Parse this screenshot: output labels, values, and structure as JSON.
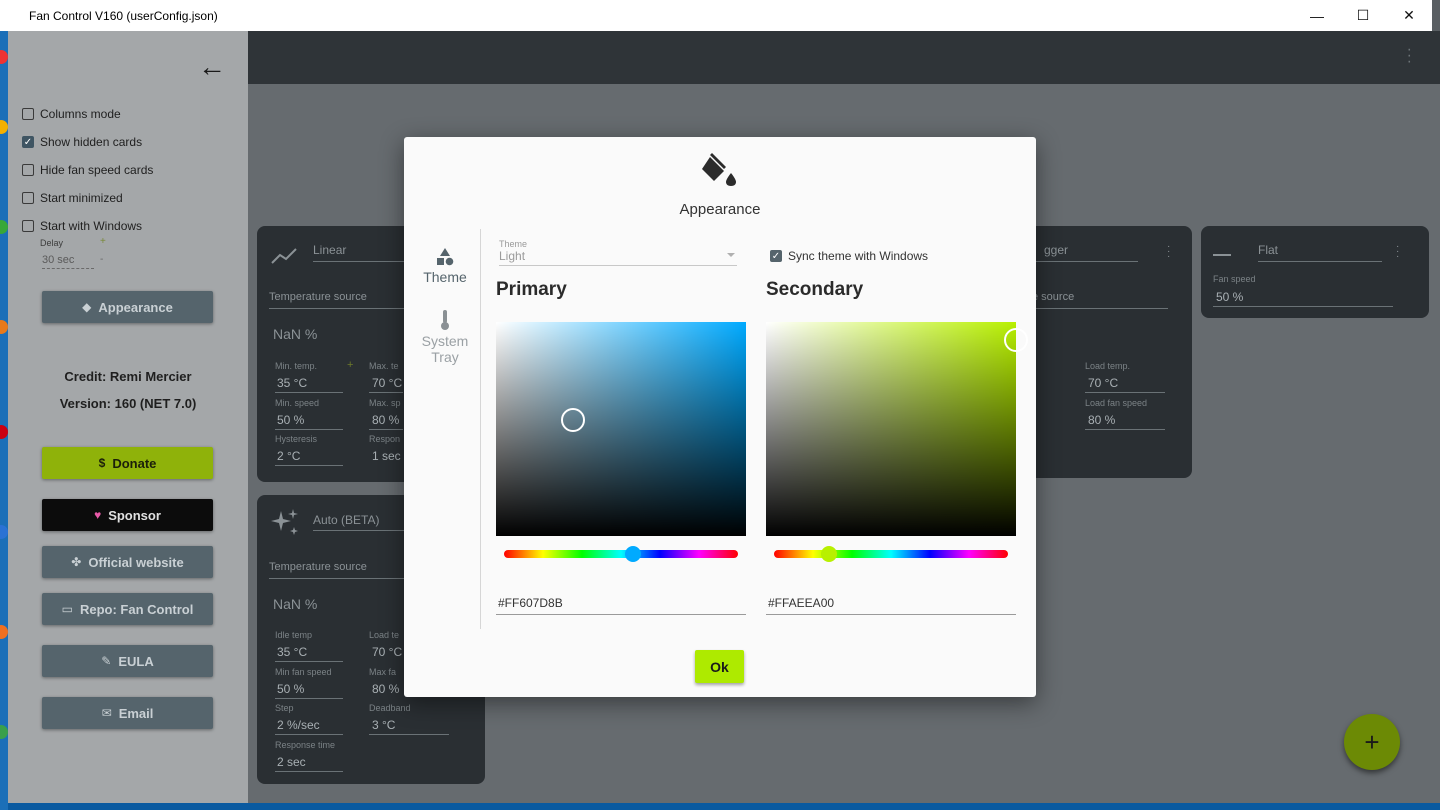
{
  "window": {
    "title": "Fan Control V160 (userConfig.json)",
    "controls": [
      "—",
      "☐",
      "✕"
    ]
  },
  "sidebar": {
    "checkboxes": [
      {
        "label": "Columns mode",
        "checked": false
      },
      {
        "label": "Show hidden cards",
        "checked": true
      },
      {
        "label": "Hide fan speed cards",
        "checked": false
      },
      {
        "label": "Start minimized",
        "checked": false
      },
      {
        "label": "Start with Windows",
        "checked": false
      }
    ],
    "delay_label": "Delay",
    "delay_value": "30 sec",
    "buttons": {
      "appearance": "Appearance",
      "donate": "Donate",
      "sponsor": "Sponsor",
      "website": "Official website",
      "repo": "Repo: Fan Control",
      "eula": "EULA",
      "email": "Email"
    },
    "credit": "Credit: Remi Mercier",
    "version": "Version: 160 (NET 7.0)"
  },
  "cards": {
    "linear": {
      "title": "Linear",
      "source_label": "Temperature source",
      "value": "NaN %",
      "min_temp_label": "Min. temp.",
      "min_temp": "35 °C",
      "max_temp_label": "Max. te",
      "max_temp": "70 °C",
      "min_speed_label": "Min. speed",
      "min_speed": "50 %",
      "max_speed_label": "Max. sp",
      "max_speed": "80 %",
      "hysteresis_label": "Hysteresis",
      "hysteresis": "2 °C",
      "response_label": "Respon",
      "response": "1 sec"
    },
    "auto": {
      "title": "Auto (BETA)",
      "source_label": "Temperature source",
      "value": "NaN %",
      "idle_temp_label": "Idle temp",
      "idle_temp": "35 °C",
      "load_temp_label": "Load te",
      "load_temp": "70 °C",
      "min_fan_label": "Min fan speed",
      "min_fan": "50 %",
      "max_fan_label": "Max fa",
      "max_fan": "80 %",
      "step_label": "Step",
      "step": "2 %/sec",
      "deadband_label": "Deadband",
      "deadband": "3 °C",
      "response_label": "Response time",
      "response": "2 sec"
    },
    "trigger": {
      "title": "gger",
      "source_label": "e source",
      "load_temp_label": "Load temp.",
      "load_temp": "70 °C",
      "load_fan_label": "Load fan speed",
      "load_fan": "80 %"
    },
    "flat": {
      "title": "Flat",
      "fan_speed_label": "Fan speed",
      "fan_speed": "50 %"
    }
  },
  "dialog": {
    "title": "Appearance",
    "icon": "paint-bucket-icon",
    "tabs": [
      {
        "label": "Theme",
        "icon": "shapes-icon",
        "active": true
      },
      {
        "label": "System Tray",
        "icon": "thermometer-icon",
        "active": false
      }
    ],
    "theme_label": "Theme",
    "theme_value": "Light",
    "sync_label": "Sync theme with Windows",
    "sync_checked": true,
    "primary": {
      "heading": "Primary",
      "hex": "#FF607D8B",
      "color": "#607D8B",
      "hue_color": "#00aaff"
    },
    "secondary": {
      "heading": "Secondary",
      "hex": "#FFAEEA00",
      "color": "#AEEA00",
      "hue_color": "#b8f000"
    },
    "ok_label": "Ok"
  },
  "fab_label": "+"
}
